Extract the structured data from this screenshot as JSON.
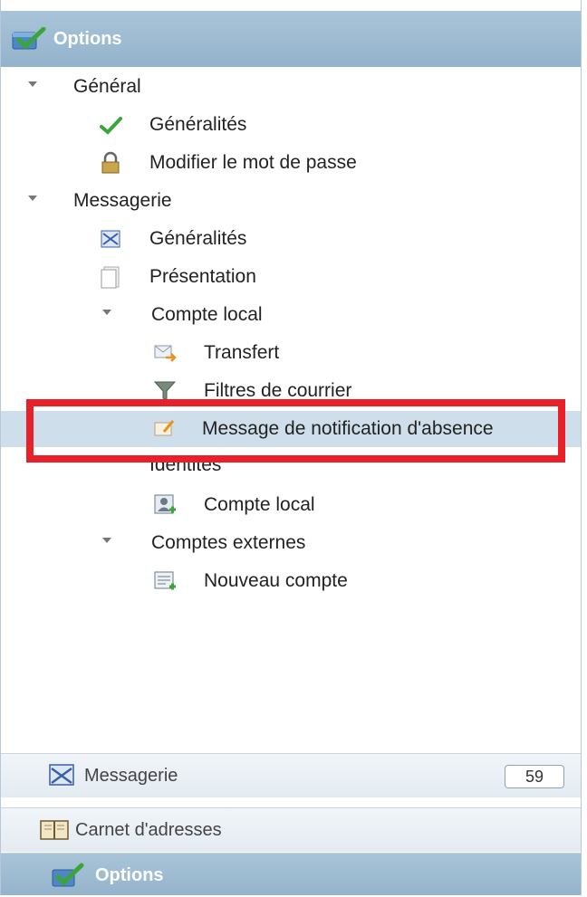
{
  "header": {
    "title": "Options",
    "icon": "check-icon"
  },
  "tree": [
    {
      "label": "Général",
      "icon": "",
      "expanded": true
    },
    {
      "label": "Généralités",
      "icon": "checkmark-icon"
    },
    {
      "label": "Modifier le mot de passe",
      "icon": "lock-icon"
    },
    {
      "label": "Messagerie",
      "icon": "",
      "expanded": true
    },
    {
      "label": "Généralités",
      "icon": "mail-settings-icon"
    },
    {
      "label": "Présentation",
      "icon": "document-icon"
    },
    {
      "label": "Compte local",
      "icon": "",
      "expanded": true
    },
    {
      "label": "Transfert",
      "icon": "forward-mail-icon"
    },
    {
      "label": "Filtres de courrier",
      "icon": "filter-icon"
    },
    {
      "label": "Message de notification d'absence",
      "icon": "away-message-icon",
      "selected": true
    },
    {
      "label": "Identités",
      "icon": ""
    },
    {
      "label": "Compte local",
      "icon": "identity-icon"
    },
    {
      "label": "Comptes externes",
      "icon": "",
      "expanded": true
    },
    {
      "label": "Nouveau compte",
      "icon": "new-account-icon"
    }
  ],
  "sections": {
    "messagerie": {
      "label": "Messagerie",
      "count": "59"
    },
    "carnet": {
      "label": "Carnet d'adresses"
    },
    "options": {
      "label": "Options"
    }
  },
  "colors": {
    "header": "#9bbad0",
    "selected": "#cfdeeb",
    "highlight": "#e8202a"
  }
}
